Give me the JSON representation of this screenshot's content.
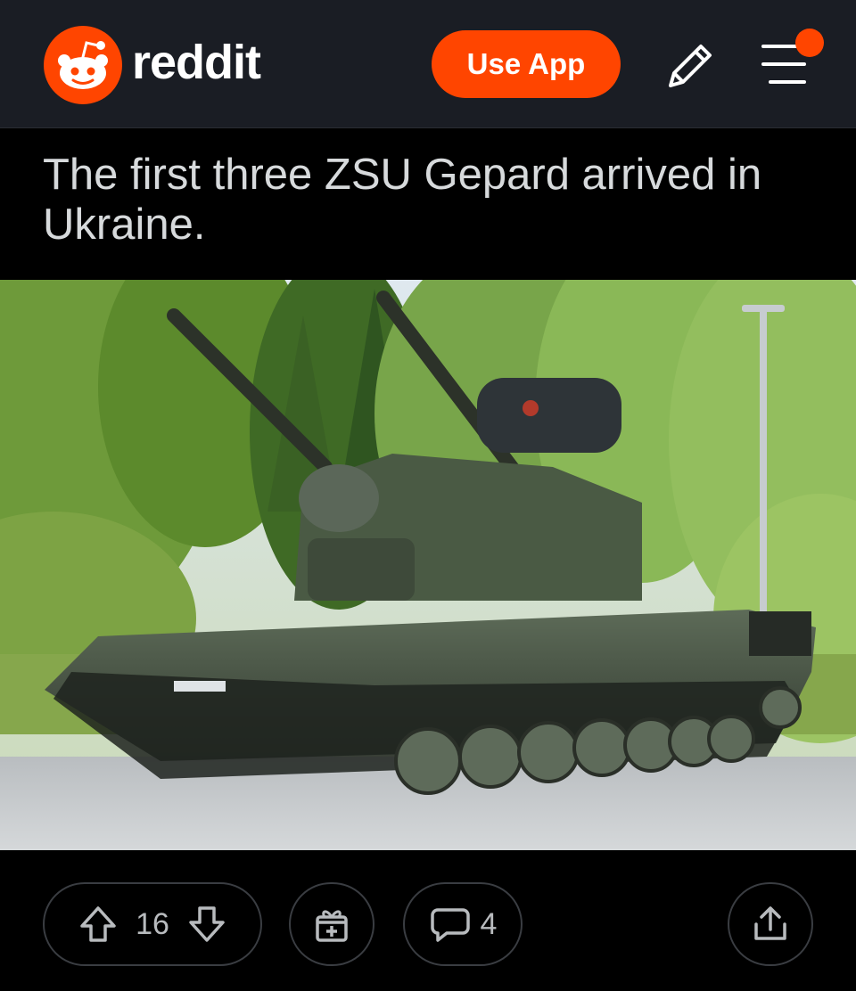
{
  "header": {
    "brand_text": "reddit",
    "use_app_label": "Use App",
    "accent_color": "#ff4500",
    "icons": [
      "reddit-logo-icon",
      "pencil-icon",
      "menu-icon",
      "notification-dot-icon"
    ]
  },
  "post": {
    "title": "The first three ZSU Gepard arrived in Ukraine.",
    "image_alt": "Gepard anti-aircraft tank with twin cannons parked on a road in front of trees",
    "upvotes": "16",
    "comments": "4"
  },
  "actions": {
    "icons": [
      "upvote-arrow-icon",
      "downvote-arrow-icon",
      "award-gift-icon",
      "comment-bubble-icon",
      "share-icon"
    ]
  }
}
